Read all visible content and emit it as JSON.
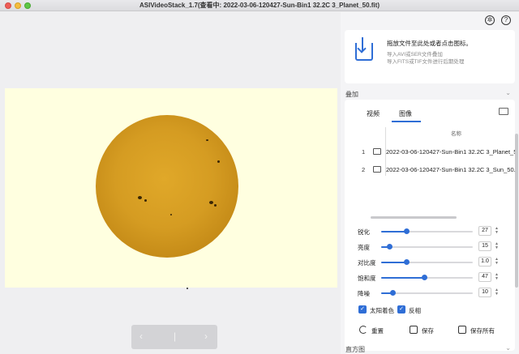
{
  "window": {
    "title": "ASIVideoStack_1.7(查看中: 2022-03-06-120427-Sun-Bin1 32.2C 3_Planet_50.fit)"
  },
  "navigator": {
    "prev": "‹",
    "divider": "|",
    "next": "›"
  },
  "import": {
    "headline": "拖放文件至此处或者点击图标。",
    "line1": "导入AVI或SER文件叠加",
    "line2": "导入FITS或TIF文件进行后期处理"
  },
  "sections": {
    "stack": "叠加",
    "histogram": "直方图"
  },
  "tabs": [
    {
      "label": "视频",
      "active": false
    },
    {
      "label": "图像",
      "active": true
    }
  ],
  "file_list": {
    "column_name": "名称",
    "rows": [
      {
        "index": "1",
        "name": "2022-03-06-120427-Sun-Bin1 32.2C 3_Planet_50.fit"
      },
      {
        "index": "2",
        "name": "2022-03-06-120427-Sun-Bin1 32.2C 3_Sun_50.fit"
      }
    ]
  },
  "adjustments": [
    {
      "label": "锐化",
      "value": "27",
      "fraction": 0.27
    },
    {
      "label": "亮度",
      "value": "15",
      "fraction": 0.09
    },
    {
      "label": "对比度",
      "value": "1.0",
      "fraction": 0.27
    },
    {
      "label": "饱和度",
      "value": "47",
      "fraction": 0.47
    },
    {
      "label": "降噪",
      "value": "10",
      "fraction": 0.12
    }
  ],
  "options": [
    {
      "label": "太阳着色",
      "checked": true
    },
    {
      "label": "反相",
      "checked": true
    }
  ],
  "actions": {
    "reset": "重置",
    "save": "保存",
    "save_all": "保存所有"
  },
  "colors": {
    "accent": "#2f6ed6",
    "preview_bg": "#ffffe0",
    "sun": "#d59c22"
  },
  "icons": {
    "settings": "gear-icon",
    "help": "help-icon",
    "folder": "folder-icon",
    "import": "import-icon"
  }
}
